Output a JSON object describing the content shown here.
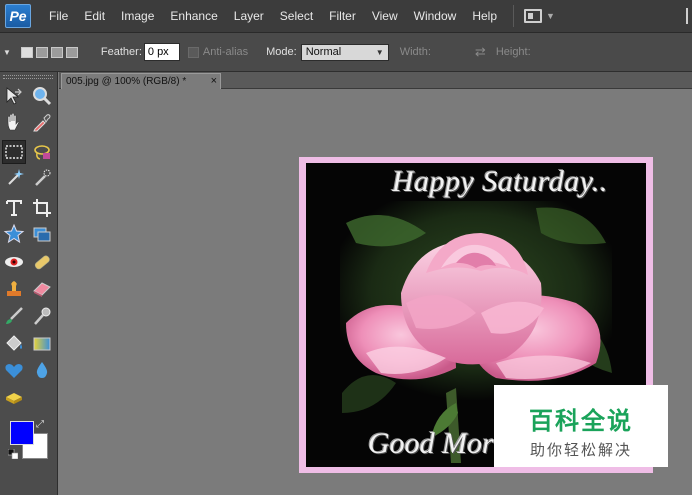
{
  "menubar": {
    "app_logo_text": "Pe",
    "items": [
      "File",
      "Edit",
      "Image",
      "Enhance",
      "Layer",
      "Select",
      "Filter",
      "View",
      "Window",
      "Help"
    ]
  },
  "options": {
    "feather_label": "Feather:",
    "feather_value": "0 px",
    "antialias_label": "Anti-alias",
    "mode_label": "Mode:",
    "mode_value": "Normal",
    "width_label": "Width:",
    "height_label": "Height:"
  },
  "document": {
    "tab_title": "005.jpg @ 100% (RGB/8) *",
    "tab_close": "×"
  },
  "canvas": {
    "greeting_top": "Happy Saturday..",
    "greeting_bottom": "Good Mornin"
  },
  "toolbox": {
    "foreground_color": "#0000ff",
    "background_color": "#ffffff"
  },
  "watermark": {
    "title": "百科全说",
    "subtitle": "助你轻松解决"
  }
}
